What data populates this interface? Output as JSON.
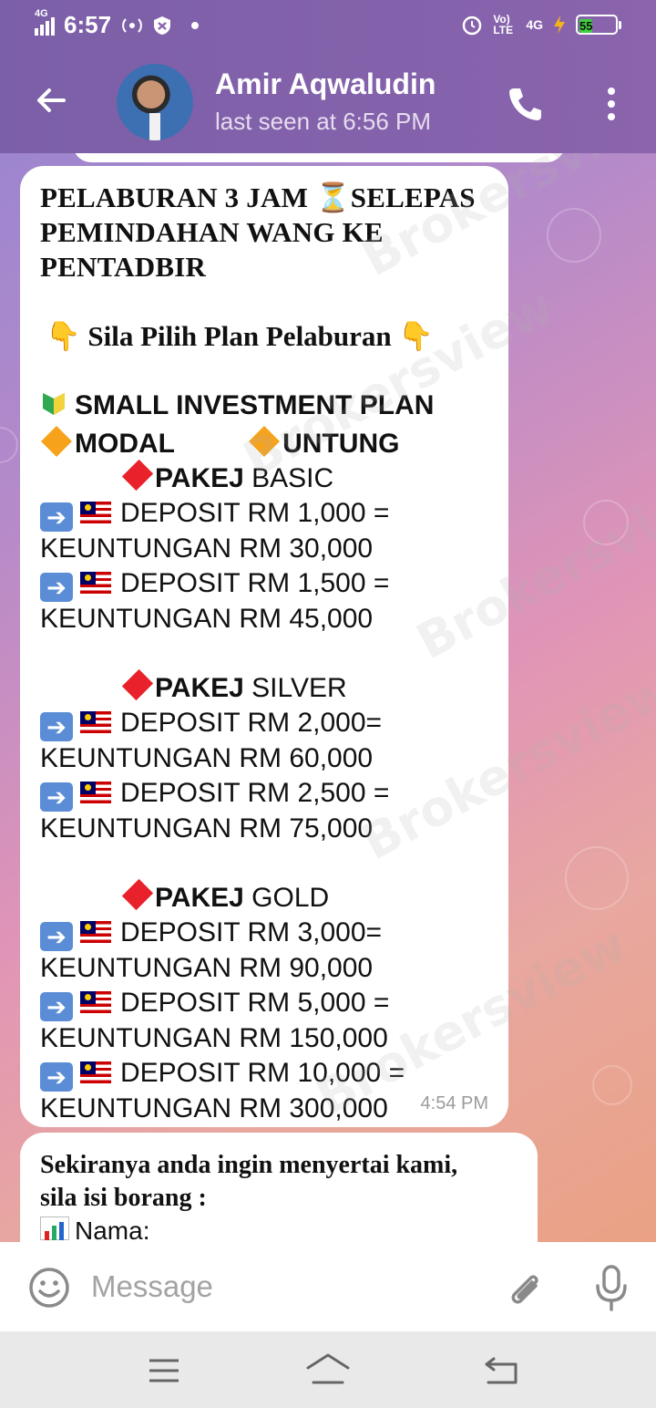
{
  "status_bar": {
    "network": "4G",
    "time": "6:57",
    "volte": "Vo) LTE",
    "data_network": "4G",
    "battery_level": "55"
  },
  "header": {
    "contact_name": "Amir Aqwaludin",
    "last_seen": "last seen at 6:56 PM"
  },
  "message1": {
    "title": "PELABURAN 3 JAM ⏳SELEPAS PEMINDAHAN WANG KE PENTADBIR",
    "subtitle": "👇 Sila Pilih Plan Pelaburan 👇",
    "plan_heading": "SMALL INVESTMENT PLAN",
    "col_modal": "MODAL",
    "col_untung": "UNTUNG",
    "packages": [
      {
        "prefix": "PAKEJ",
        "name": "BASIC",
        "items": [
          {
            "deposit": "DEPOSIT RM 1,000 =",
            "profit": "KEUNTUNGAN RM 30,000"
          },
          {
            "deposit": "DEPOSIT RM 1,500 =",
            "profit": "KEUNTUNGAN RM 45,000"
          }
        ]
      },
      {
        "prefix": "PAKEJ",
        "name": "SILVER",
        "items": [
          {
            "deposit": "DEPOSIT RM 2,000=",
            "profit": "KEUNTUNGAN RM 60,000"
          },
          {
            "deposit": "DEPOSIT RM 2,500 =",
            "profit": "KEUNTUNGAN RM 75,000"
          }
        ]
      },
      {
        "prefix": "PAKEJ",
        "name": "GOLD",
        "items": [
          {
            "deposit": "DEPOSIT RM 3,000=",
            "profit": "KEUNTUNGAN RM 90,000"
          },
          {
            "deposit": "DEPOSIT RM 5,000 =",
            "profit": "KEUNTUNGAN RM 150,000"
          },
          {
            "deposit": "DEPOSIT RM 10,000 =",
            "profit": "KEUNTUNGAN RM 300,000"
          }
        ]
      }
    ],
    "timestamp": "4:54 PM"
  },
  "message2": {
    "line1": "Sekiranya anda ingin menyertai kami,",
    "line2": "sila isi borang :",
    "line3": "Nama:"
  },
  "input": {
    "placeholder": "Message"
  },
  "watermark": "Brokersview",
  "colors": {
    "header_purple": "#7b5fa8",
    "bubble_bg": "#ffffff",
    "timestamp_gray": "#9b9b9b"
  }
}
